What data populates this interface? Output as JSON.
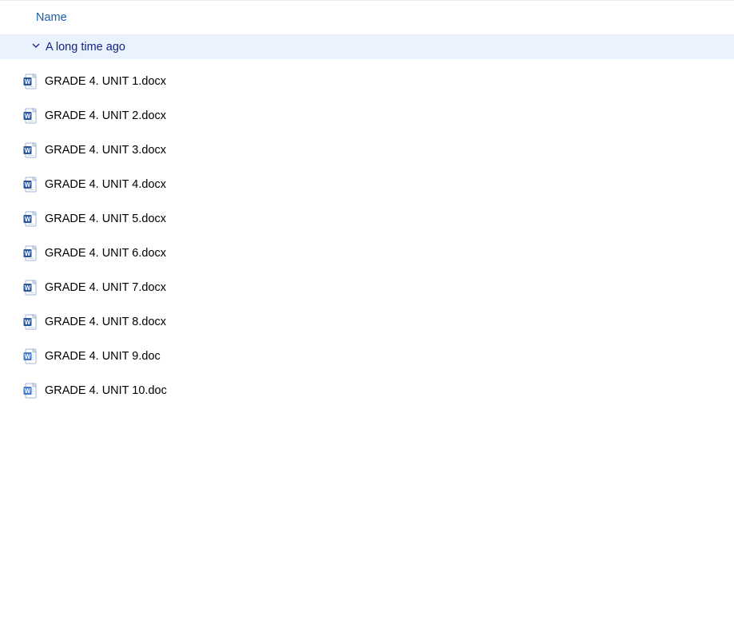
{
  "header": {
    "name_column": "Name"
  },
  "group": {
    "label": "A long time ago"
  },
  "files": [
    {
      "name": "GRADE 4. UNIT 1.docx",
      "type": "docx"
    },
    {
      "name": "GRADE 4. UNIT 2.docx",
      "type": "docx"
    },
    {
      "name": "GRADE 4. UNIT 3.docx",
      "type": "docx"
    },
    {
      "name": "GRADE 4. UNIT 4.docx",
      "type": "docx"
    },
    {
      "name": "GRADE 4. UNIT 5.docx",
      "type": "docx"
    },
    {
      "name": "GRADE 4. UNIT 6.docx",
      "type": "docx"
    },
    {
      "name": "GRADE 4. UNIT 7.docx",
      "type": "docx"
    },
    {
      "name": "GRADE 4. UNIT 8.docx",
      "type": "docx"
    },
    {
      "name": "GRADE 4. UNIT 9.doc",
      "type": "doc"
    },
    {
      "name": "GRADE 4. UNIT 10.doc",
      "type": "doc"
    }
  ]
}
